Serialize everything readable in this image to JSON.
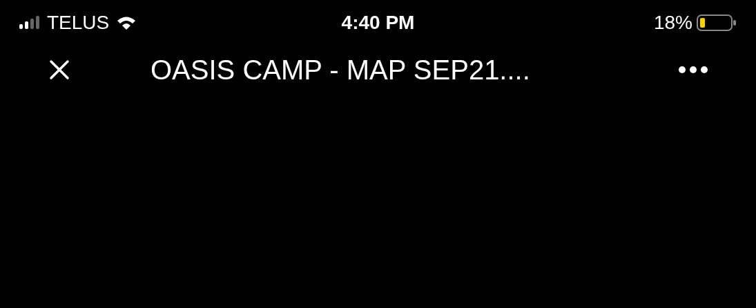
{
  "status_bar": {
    "carrier": "TELUS",
    "time": "4:40 PM",
    "battery": "18%"
  },
  "nav_bar": {
    "title": "OASIS CAMP - MAP SEP21...."
  }
}
